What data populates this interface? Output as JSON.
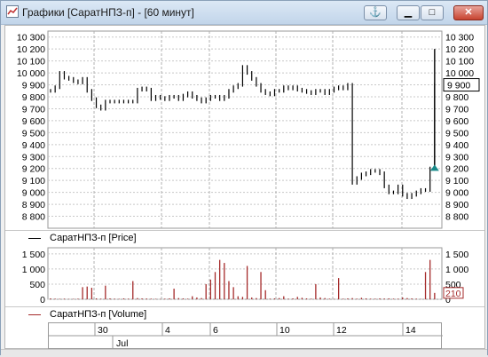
{
  "window": {
    "title": "Графики [СаратНПЗ-п] - [60 минут]"
  },
  "controls": {
    "pin_icon": "anchor-icon",
    "minimize_icon": "minimize-icon",
    "maximize_icon": "maximize-icon",
    "close_icon": "close-icon"
  },
  "price_panel": {
    "legend": "СаратНПЗ-п [Price]",
    "line_color": "#000000",
    "last_value_label": "9 900",
    "ticks": [
      "10 300",
      "10 200",
      "10 100",
      "10 000",
      "9 900",
      "9 800",
      "9 700",
      "9 600",
      "9 500",
      "9 400",
      "9 300",
      "9 200",
      "9 100",
      "9 000",
      "8 900",
      "8 800"
    ]
  },
  "volume_panel": {
    "legend": "СаратНПЗ-п [Volume]",
    "line_color": "#a52a2a",
    "last_value_label": "210",
    "ticks": [
      "1 500",
      "1 000",
      "500",
      "0"
    ]
  },
  "date_axis": {
    "days": [
      "30",
      "4",
      "6",
      "10",
      "12",
      "14"
    ],
    "month": "Jul"
  },
  "chart_data": [
    {
      "type": "line",
      "title": "",
      "series": [
        {
          "name": "СаратНПЗ-п [Price]",
          "values": [
            9850,
            9880,
            10000,
            9960,
            9950,
            9930,
            9920,
            9950,
            9850,
            9780,
            9720,
            9700,
            9760,
            9760,
            9760,
            9760,
            9760,
            9760,
            9760,
            9860,
            9870,
            9860,
            9780,
            9800,
            9790,
            9780,
            9800,
            9800,
            9780,
            9810,
            9830,
            9800,
            9780,
            9760,
            9780,
            9800,
            9800,
            9780,
            9800,
            9850,
            9880,
            9900,
            10050,
            10000,
            9950,
            9900,
            9850,
            9830,
            9820,
            9850,
            9850,
            9880,
            9870,
            9880,
            9860,
            9850,
            9840,
            9830,
            9850,
            9850,
            9830,
            9850,
            9870,
            9880,
            9870,
            9900,
            9080,
            9120,
            9150,
            9160,
            9180,
            9180,
            9160,
            9050,
            9000,
            9000,
            9050,
            8980,
            8960,
            8980,
            9000,
            9020,
            9020,
            9200,
            9900
          ]
        },
        {
          "name": "СаратНПЗ-п [Volume]",
          "values": [
            30,
            20,
            15,
            20,
            10,
            15,
            20,
            400,
            420,
            380,
            30,
            20,
            450,
            30,
            20,
            15,
            30,
            20,
            600,
            40,
            30,
            25,
            20,
            15,
            10,
            20,
            30,
            350,
            40,
            30,
            20,
            100,
            60,
            40,
            500,
            650,
            900,
            1300,
            1200,
            600,
            400,
            100,
            80,
            1100,
            60,
            40,
            900,
            300,
            20,
            30,
            40,
            100,
            20,
            30,
            80,
            50,
            30,
            20,
            500,
            60,
            40,
            20,
            10,
            700,
            20,
            30,
            40,
            20,
            50,
            30,
            20,
            20,
            30,
            25,
            30,
            20,
            20,
            60,
            40,
            30,
            20,
            10,
            900,
            1300,
            210
          ]
        }
      ],
      "ylim_price": [
        8700,
        10350
      ],
      "ylim_volume": [
        0,
        1700
      ],
      "grid": true,
      "legend": "bottom-left"
    }
  ]
}
